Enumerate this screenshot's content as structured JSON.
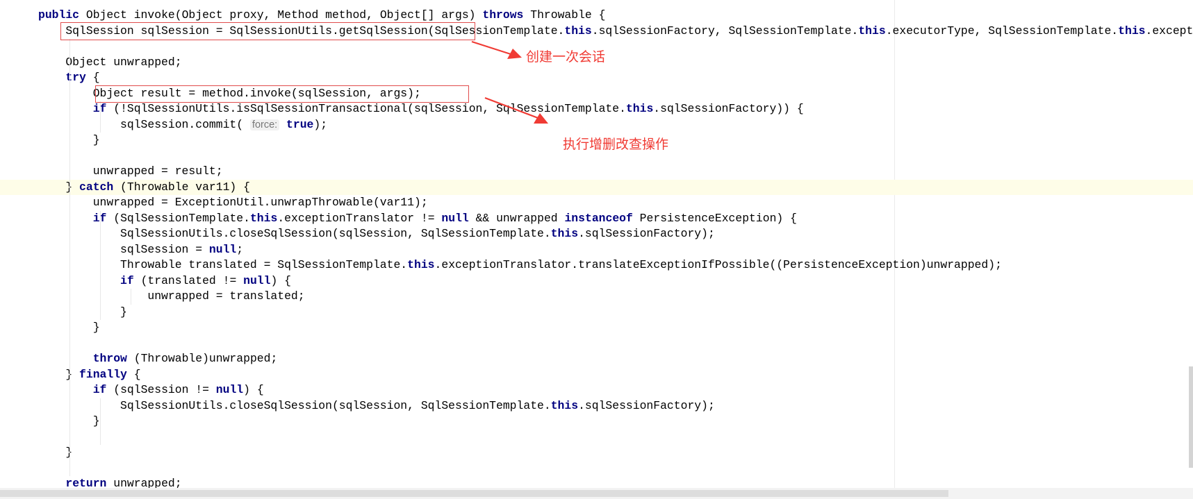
{
  "annotations": {
    "create_session": "创建一次会话",
    "execute_crud": "执行增删改查操作"
  },
  "inlay_hint": "force:",
  "colors": {
    "annotation_red": "#f03b34",
    "keyword": "#000080",
    "current_line": "#fefde8"
  },
  "code_lines": [
    [
      [
        "kw",
        "public"
      ],
      [
        "t",
        " Object invoke(Object proxy, Method method, Object[] args) "
      ],
      [
        "kw",
        "throws"
      ],
      [
        "t",
        " Throwable {"
      ]
    ],
    [
      [
        "t",
        "    SqlSession sqlSession = SqlSessionUtils.getSqlSession(SqlSessionTemplate."
      ],
      [
        "kw",
        "this"
      ],
      [
        "t",
        ".sqlSessionFactory, SqlSessionTemplate."
      ],
      [
        "kw",
        "this"
      ],
      [
        "t",
        ".executorType, SqlSessionTemplate."
      ],
      [
        "kw",
        "this"
      ],
      [
        "t",
        ".exceptionTranslator);"
      ]
    ],
    [],
    [
      [
        "t",
        "    Object unwrapped;"
      ]
    ],
    [
      [
        "t",
        "    "
      ],
      [
        "kw",
        "try"
      ],
      [
        "t",
        " {"
      ]
    ],
    [
      [
        "t",
        "        Object result = method.invoke(sqlSession, args);"
      ]
    ],
    [
      [
        "t",
        "        "
      ],
      [
        "kw",
        "if"
      ],
      [
        "t",
        " (!SqlSessionUtils.isSqlSessionTransactional(sqlSession, SqlSessionTemplate."
      ],
      [
        "kw",
        "this"
      ],
      [
        "t",
        ".sqlSessionFactory)) {"
      ]
    ],
    [
      [
        "t",
        "            sqlSession.commit( "
      ],
      [
        "hint",
        "force:"
      ],
      [
        "t",
        " "
      ],
      [
        "kw",
        "true"
      ],
      [
        "t",
        ");"
      ]
    ],
    [
      [
        "t",
        "        }"
      ]
    ],
    [],
    [
      [
        "t",
        "        unwrapped = result;"
      ]
    ],
    [
      [
        "t",
        "    } "
      ],
      [
        "kw",
        "catch"
      ],
      [
        "t",
        " (Throwable var11) {"
      ]
    ],
    [
      [
        "t",
        "        unwrapped = ExceptionUtil.unwrapThrowable(var11);"
      ]
    ],
    [
      [
        "t",
        "        "
      ],
      [
        "kw",
        "if"
      ],
      [
        "t",
        " (SqlSessionTemplate."
      ],
      [
        "kw",
        "this"
      ],
      [
        "t",
        ".exceptionTranslator != "
      ],
      [
        "kw",
        "null"
      ],
      [
        "t",
        " && unwrapped "
      ],
      [
        "kw",
        "instanceof"
      ],
      [
        "t",
        " PersistenceException) {"
      ]
    ],
    [
      [
        "t",
        "            SqlSessionUtils.closeSqlSession(sqlSession, SqlSessionTemplate."
      ],
      [
        "kw",
        "this"
      ],
      [
        "t",
        ".sqlSessionFactory);"
      ]
    ],
    [
      [
        "t",
        "            sqlSession = "
      ],
      [
        "kw",
        "null"
      ],
      [
        "t",
        ";"
      ]
    ],
    [
      [
        "t",
        "            Throwable translated = SqlSessionTemplate."
      ],
      [
        "kw",
        "this"
      ],
      [
        "t",
        ".exceptionTranslator.translateExceptionIfPossible((PersistenceException)unwrapped);"
      ]
    ],
    [
      [
        "t",
        "            "
      ],
      [
        "kw",
        "if"
      ],
      [
        "t",
        " (translated != "
      ],
      [
        "kw",
        "null"
      ],
      [
        "t",
        ") {"
      ]
    ],
    [
      [
        "t",
        "                unwrapped = translated;"
      ]
    ],
    [
      [
        "t",
        "            }"
      ]
    ],
    [
      [
        "t",
        "        }"
      ]
    ],
    [],
    [
      [
        "t",
        "        "
      ],
      [
        "kw",
        "throw"
      ],
      [
        "t",
        " (Throwable)unwrapped;"
      ]
    ],
    [
      [
        "t",
        "    } "
      ],
      [
        "kw",
        "finally"
      ],
      [
        "t",
        " {"
      ]
    ],
    [
      [
        "t",
        "        "
      ],
      [
        "kw",
        "if"
      ],
      [
        "t",
        " (sqlSession != "
      ],
      [
        "kw",
        "null"
      ],
      [
        "t",
        ") {"
      ]
    ],
    [
      [
        "t",
        "            SqlSessionUtils.closeSqlSession(sqlSession, SqlSessionTemplate."
      ],
      [
        "kw",
        "this"
      ],
      [
        "t",
        ".sqlSessionFactory);"
      ]
    ],
    [
      [
        "t",
        "        }"
      ]
    ],
    [],
    [
      [
        "t",
        "    }"
      ]
    ],
    [],
    [
      [
        "t",
        "    "
      ],
      [
        "kw",
        "return"
      ],
      [
        "t",
        " unwrapped;"
      ]
    ]
  ]
}
